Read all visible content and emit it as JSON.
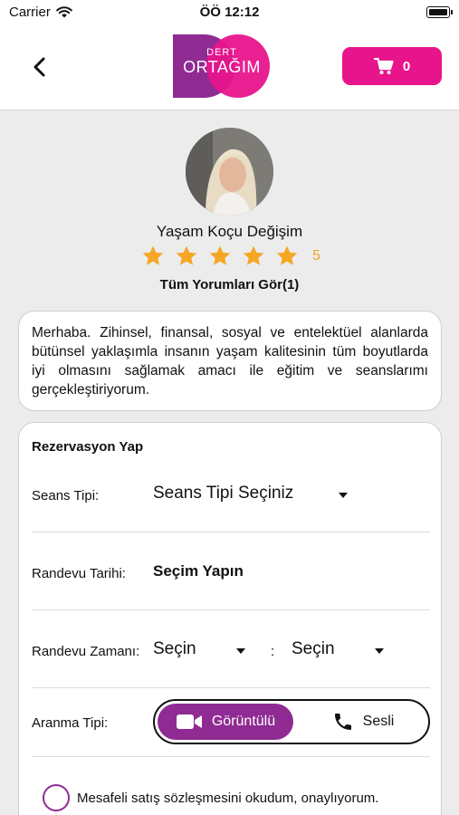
{
  "status_bar": {
    "carrier": "Carrier",
    "time": "ÖÖ 12:12"
  },
  "header": {
    "logo_line1": "DERT",
    "logo_line2": "ORTAĞIM",
    "cart_count": "0"
  },
  "profile": {
    "name": "Yaşam Koçu Değişim",
    "stars": 5,
    "rating": "5",
    "reviews_link": "Tüm Yorumları Gör(1)"
  },
  "bio": "Merhaba. Zihinsel, finansal, sosyal ve entelektüel alanlarda bütünsel yaklaşımla insanın yaşam kalitesinin tüm boyutlarda iyi olmasını sağlamak amacı ile eğitim ve seanslarımı gerçekleştiriyorum.",
  "reservation": {
    "title": "Rezervasyon Yap",
    "session_type_label": "Seans Tipi:",
    "session_type_value": "Seans Tipi Seçiniz",
    "date_label": "Randevu Tarihi:",
    "date_value": "Seçim Yapın",
    "time_label": "Randevu Zamanı:",
    "time_start_value": "Seçin",
    "time_separator": ":",
    "time_end_value": "Seçin",
    "call_type_label": "Aranma Tipi:",
    "call_video_label": "Görüntülü",
    "call_audio_label": "Sesli",
    "agreement_text": "Mesafeli satış sözleşmesini okudum, onaylıyorum."
  },
  "colors": {
    "brand_pink": "#e8148c",
    "brand_purple": "#8f2b93",
    "star": "#f5a623"
  }
}
